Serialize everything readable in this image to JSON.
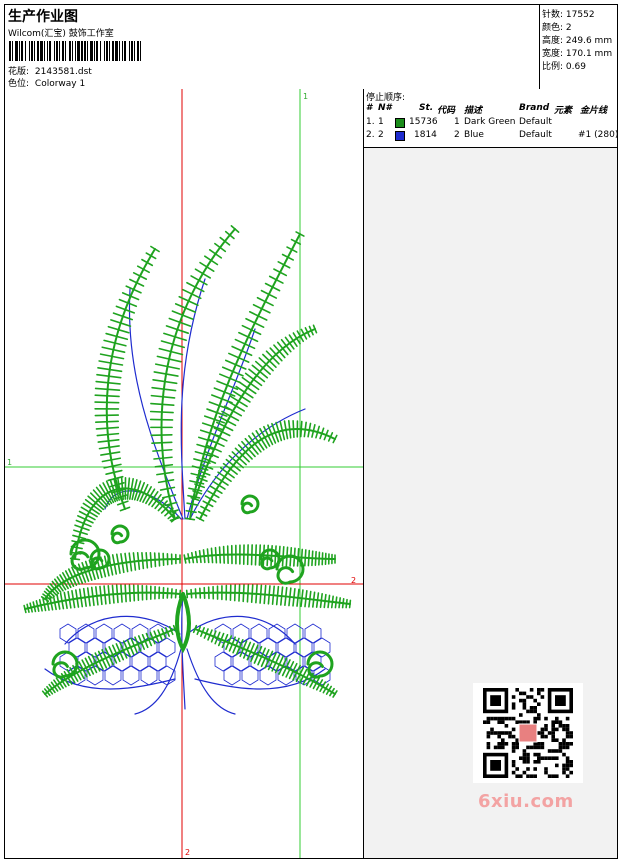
{
  "header": {
    "title": "生产作业图",
    "company": "Wilcom(汇宝) 鼓饰工作室",
    "pattern_label": "花版:",
    "pattern_value": "2143581.dst",
    "color_label": "色位:",
    "color_value": "Colorway 1"
  },
  "stats": {
    "stitches_label": "针数:",
    "stitches_value": "17552",
    "colors_label": "颜色:",
    "colors_value": "2",
    "height_label": "高度:",
    "height_value": "249.6 mm",
    "width_label": "宽度:",
    "width_value": "170.1 mm",
    "scale_label": "比例:",
    "scale_value": "0.69"
  },
  "stop_sequence": {
    "title": "停止顺序:",
    "headers": [
      "#",
      "N#",
      "St.",
      "代码",
      "描述",
      "Brand",
      "元素",
      "金片线"
    ],
    "rows": [
      {
        "index": "1.",
        "n": "1",
        "color": "#1a8c1a",
        "stitches": "15736",
        "code": "1",
        "description": "Dark Green",
        "brand": "Default",
        "element": "",
        "sequin": ""
      },
      {
        "index": "2.",
        "n": "2",
        "color": "#1f2ccf",
        "stitches": "1814",
        "code": "2",
        "description": "Blue",
        "brand": "Default",
        "element": "",
        "sequin": "#1 (280)"
      }
    ]
  },
  "canvas": {
    "marker_green_v": "1",
    "marker_green_h": "1",
    "marker_red_h": "2",
    "marker_red_v": "2"
  },
  "colors": {
    "green_thread": "#1fa31f",
    "blue_thread": "#1f2ccf",
    "guide_green": "#33cc33",
    "guide_red": "#e00000"
  },
  "watermark": "6xiu.com"
}
